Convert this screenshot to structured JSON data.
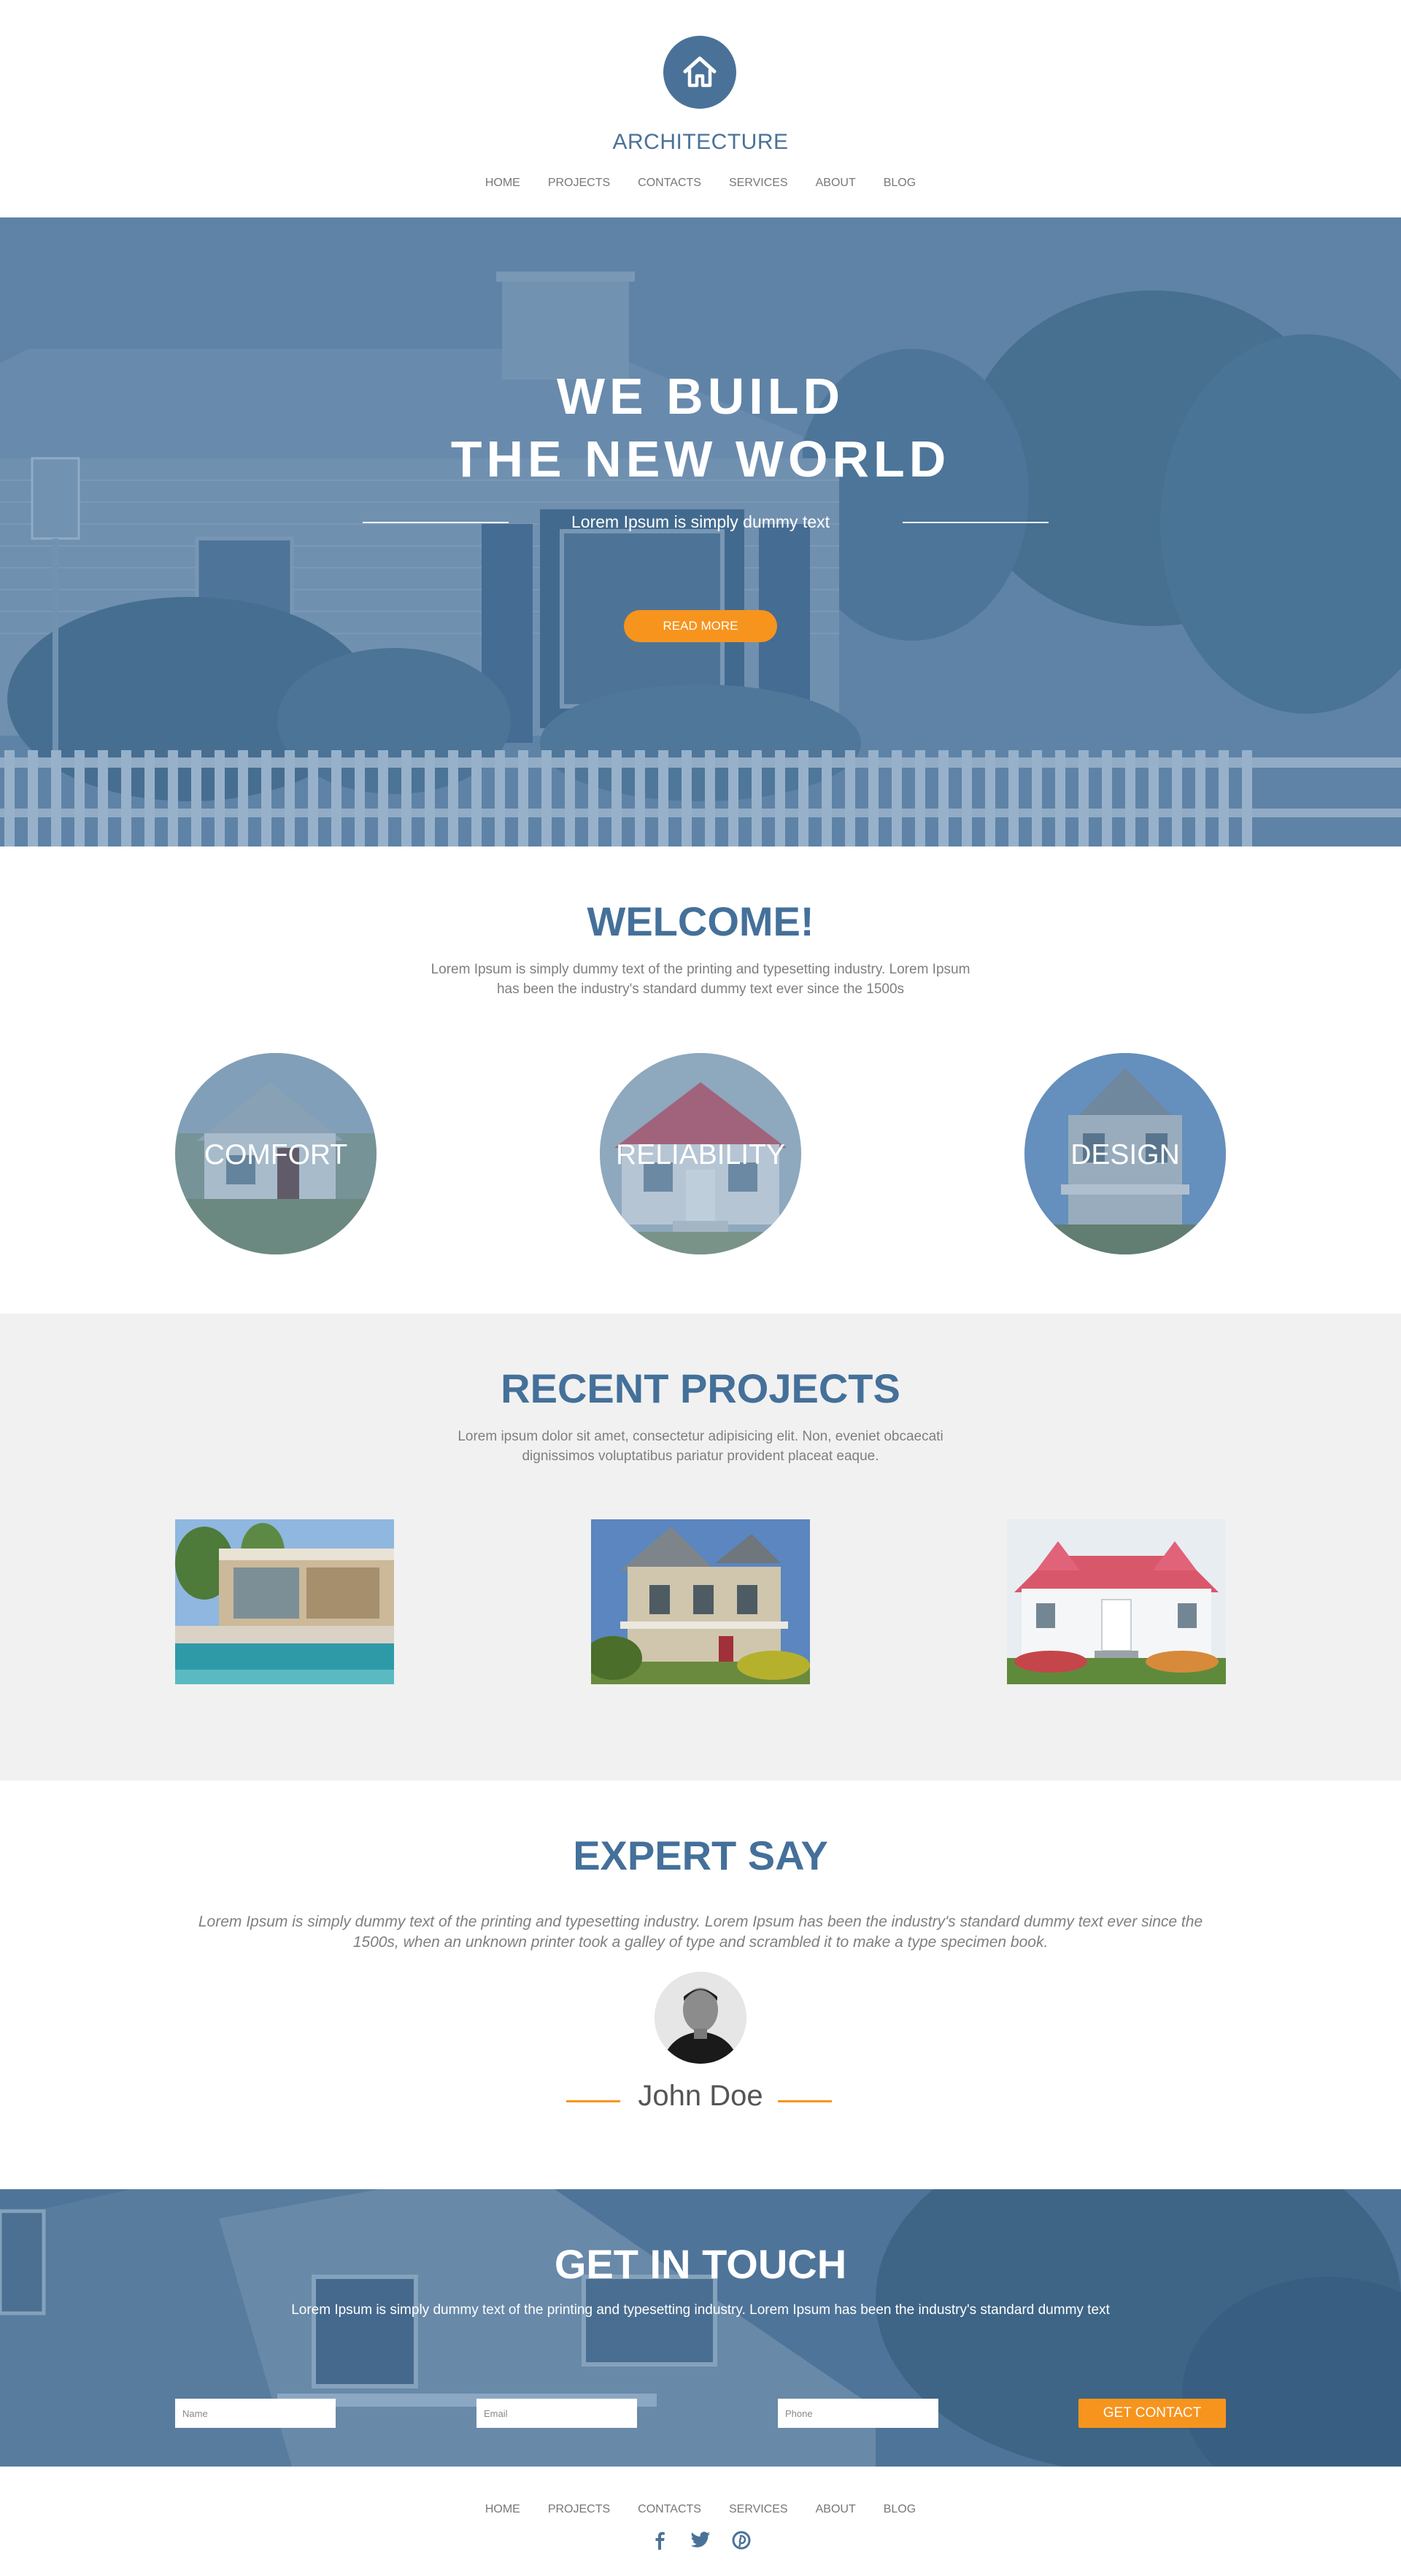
{
  "brand": {
    "logo_icon": "house-icon",
    "name": "ARCHITECTURE",
    "color": "#4a7298"
  },
  "nav": {
    "items": [
      {
        "label": "HOME"
      },
      {
        "label": "PROJECTS"
      },
      {
        "label": "CONTACTS"
      },
      {
        "label": "SERVICES"
      },
      {
        "label": "ABOUT"
      },
      {
        "label": "BLOG"
      }
    ]
  },
  "hero": {
    "title_line1": "WE BUILD",
    "title_line2": "THE NEW WORLD",
    "subtitle": "Lorem Ipsum is simply dummy text",
    "button": "READ MORE"
  },
  "welcome": {
    "title": "WELCOME!",
    "description": "Lorem Ipsum is simply dummy text of the printing and typesetting industry. Lorem Ipsum has been the industry's standard dummy text ever since the 1500s",
    "features": [
      {
        "label": "COMFORT"
      },
      {
        "label": "RELIABILITY"
      },
      {
        "label": "DESIGN"
      }
    ]
  },
  "projects": {
    "title": "RECENT PROJECTS",
    "description": "Lorem ipsum dolor sit amet, consectetur adipisicing elit. Non, eveniet obcaecati dignissimos voluptatibus pariatur provident placeat eaque."
  },
  "expert": {
    "title": "EXPERT SAY",
    "quote": "Lorem Ipsum is simply dummy text of the printing and typesetting industry. Lorem Ipsum has been the industry's standard dummy text ever since the 1500s, when an unknown printer took a galley of type and scrambled it to make a type specimen book.",
    "name": "John Doe"
  },
  "contact": {
    "title": "GET IN TOUCH",
    "description": "Lorem Ipsum is simply dummy text of the printing and typesetting industry. Lorem Ipsum has been the industry's standard dummy text",
    "name_placeholder": "Name",
    "email_placeholder": "Email",
    "phone_placeholder": "Phone",
    "button": "GET CONTACT"
  },
  "footer": {
    "social_icons": [
      "facebook-icon",
      "twitter-icon",
      "pinterest-icon"
    ]
  },
  "colors": {
    "primary": "#4a7298",
    "accent": "#f7941d",
    "section_gray": "#f1f1f1"
  }
}
